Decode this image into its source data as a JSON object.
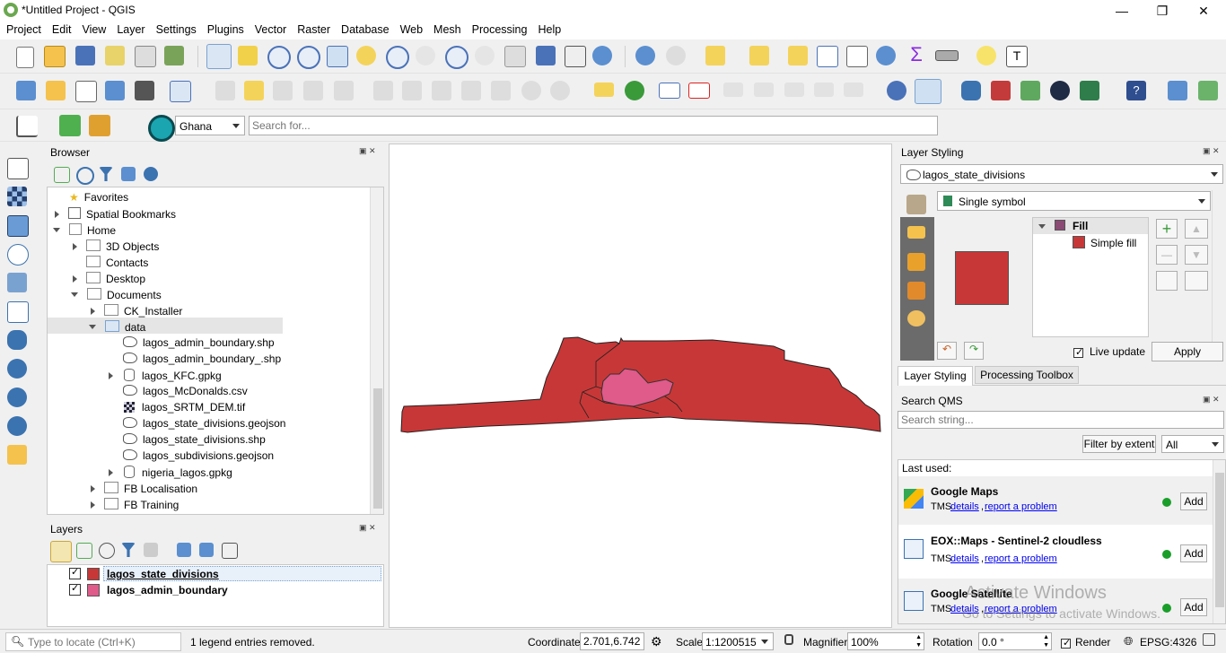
{
  "window": {
    "title": "*Untitled Project - QGIS",
    "minimize": "—",
    "restore": "❐",
    "close": "✕"
  },
  "menu": [
    "Project",
    "Edit",
    "View",
    "Layer",
    "Settings",
    "Plugins",
    "Vector",
    "Raster",
    "Database",
    "Web",
    "Mesh",
    "Processing",
    "Help"
  ],
  "locator_bar": {
    "country": "Ghana",
    "search_placeholder": "Search for..."
  },
  "browser": {
    "title": "Browser",
    "items": [
      {
        "label": "Favorites"
      },
      {
        "label": "Spatial Bookmarks"
      },
      {
        "label": "Home"
      },
      {
        "label": "3D Objects"
      },
      {
        "label": "Contacts"
      },
      {
        "label": "Desktop"
      },
      {
        "label": "Documents"
      },
      {
        "label": "CK_Installer"
      },
      {
        "label": "data"
      },
      {
        "label": "lagos_admin_boundary.shp"
      },
      {
        "label": "lagos_admin_boundary_.shp"
      },
      {
        "label": "lagos_KFC.gpkg"
      },
      {
        "label": "lagos_McDonalds.csv"
      },
      {
        "label": "lagos_SRTM_DEM.tif"
      },
      {
        "label": "lagos_state_divisions.geojson"
      },
      {
        "label": "lagos_state_divisions.shp"
      },
      {
        "label": "lagos_subdivisions.geojson"
      },
      {
        "label": "nigeria_lagos.gpkg"
      },
      {
        "label": "FB Localisation"
      },
      {
        "label": "FB Training"
      }
    ]
  },
  "layers": {
    "title": "Layers",
    "items": [
      {
        "label": "lagos_state_divisions",
        "color": "#c83737"
      },
      {
        "label": "lagos_admin_boundary",
        "color": "#e05a8a"
      }
    ]
  },
  "map": {
    "fill_main": "#c83737",
    "fill_admin": "#e05a8a"
  },
  "styling": {
    "title": "Layer Styling",
    "layer": "lagos_state_divisions",
    "renderer": "Single symbol",
    "tree_fill": "Fill",
    "tree_simple": "Simple fill",
    "live_update": "Live update",
    "apply": "Apply",
    "tab_styling": "Layer Styling",
    "tab_toolbox": "Processing Toolbox"
  },
  "qms": {
    "title": "Search QMS",
    "placeholder": "Search string...",
    "filter_btn": "Filter by extent",
    "filter_value": "All",
    "last_used": "Last used:",
    "entries": [
      {
        "name": "Google Maps",
        "type": "TMS",
        "details": "details",
        "report": "report a problem",
        "add": "Add"
      },
      {
        "name": "EOX::Maps - Sentinel-2 cloudless",
        "type": "TMS",
        "details": "details",
        "report": "report a problem",
        "add": "Add"
      },
      {
        "name": "Google Satellite",
        "type": "TMS",
        "details": "details",
        "report": "report a problem",
        "add": "Add"
      }
    ]
  },
  "watermark": {
    "line1": "Activate Windows",
    "line2": "Go to Settings to activate Windows."
  },
  "status": {
    "locate_placeholder": "Type to locate (Ctrl+K)",
    "message": "1 legend entries removed.",
    "coord_label": "Coordinate",
    "coord_value": "2.701,6.742",
    "scale_label": "Scale",
    "scale_value": "1:1200515",
    "magnifier_label": "Magnifier",
    "magnifier_value": "100%",
    "rotation_label": "Rotation",
    "rotation_value": "0.0 °",
    "render_label": "Render",
    "crs": "EPSG:4326"
  }
}
